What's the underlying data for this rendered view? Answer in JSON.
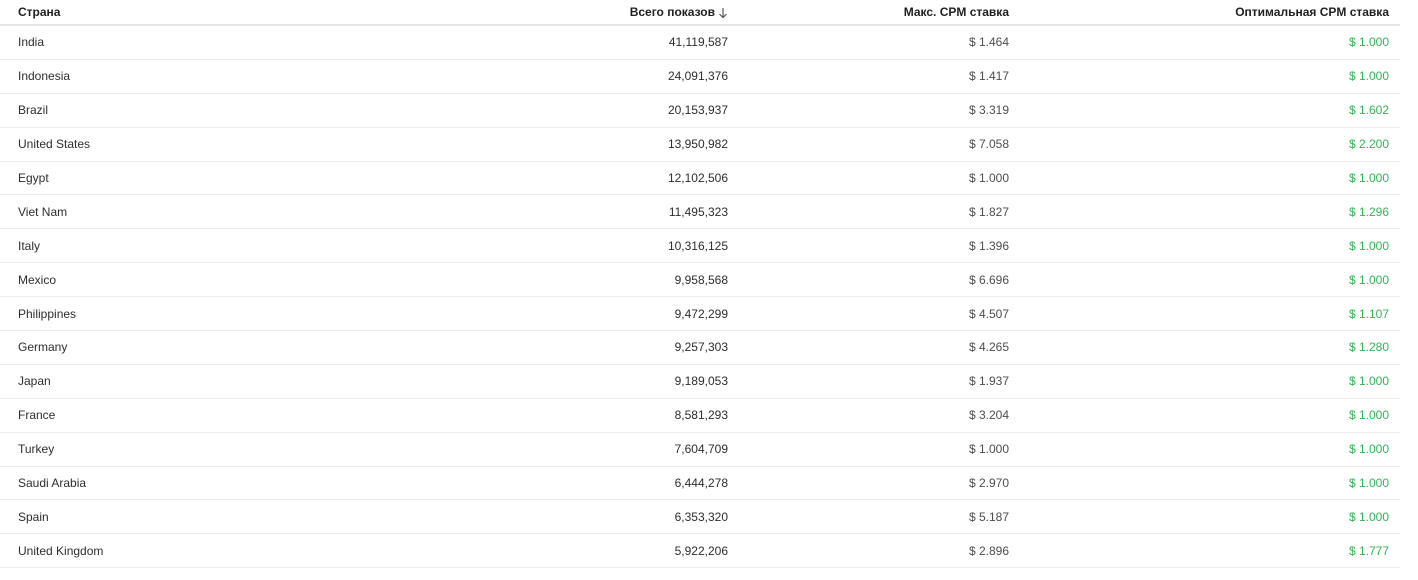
{
  "table": {
    "columns": {
      "country": "Страна",
      "impressions": "Всего показов",
      "max_cpm": "Макс. CPM ставка",
      "optimal_cpm": "Оптимальная CPM ставка"
    },
    "sort": {
      "column": "impressions",
      "direction": "desc",
      "icon": "arrow-down-icon"
    },
    "rows": [
      {
        "country": "India",
        "impressions": "41,119,587",
        "max_cpm": "$ 1.464",
        "optimal_cpm": "$ 1.000"
      },
      {
        "country": "Indonesia",
        "impressions": "24,091,376",
        "max_cpm": "$ 1.417",
        "optimal_cpm": "$ 1.000"
      },
      {
        "country": "Brazil",
        "impressions": "20,153,937",
        "max_cpm": "$ 3.319",
        "optimal_cpm": "$ 1.602"
      },
      {
        "country": "United States",
        "impressions": "13,950,982",
        "max_cpm": "$ 7.058",
        "optimal_cpm": "$ 2.200"
      },
      {
        "country": "Egypt",
        "impressions": "12,102,506",
        "max_cpm": "$ 1.000",
        "optimal_cpm": "$ 1.000"
      },
      {
        "country": "Viet Nam",
        "impressions": "11,495,323",
        "max_cpm": "$ 1.827",
        "optimal_cpm": "$ 1.296"
      },
      {
        "country": "Italy",
        "impressions": "10,316,125",
        "max_cpm": "$ 1.396",
        "optimal_cpm": "$ 1.000"
      },
      {
        "country": "Mexico",
        "impressions": "9,958,568",
        "max_cpm": "$ 6.696",
        "optimal_cpm": "$ 1.000"
      },
      {
        "country": "Philippines",
        "impressions": "9,472,299",
        "max_cpm": "$ 4.507",
        "optimal_cpm": "$ 1.107"
      },
      {
        "country": "Germany",
        "impressions": "9,257,303",
        "max_cpm": "$ 4.265",
        "optimal_cpm": "$ 1.280"
      },
      {
        "country": "Japan",
        "impressions": "9,189,053",
        "max_cpm": "$ 1.937",
        "optimal_cpm": "$ 1.000"
      },
      {
        "country": "France",
        "impressions": "8,581,293",
        "max_cpm": "$ 3.204",
        "optimal_cpm": "$ 1.000"
      },
      {
        "country": "Turkey",
        "impressions": "7,604,709",
        "max_cpm": "$ 1.000",
        "optimal_cpm": "$ 1.000"
      },
      {
        "country": "Saudi Arabia",
        "impressions": "6,444,278",
        "max_cpm": "$ 2.970",
        "optimal_cpm": "$ 1.000"
      },
      {
        "country": "Spain",
        "impressions": "6,353,320",
        "max_cpm": "$ 5.187",
        "optimal_cpm": "$ 1.000"
      },
      {
        "country": "United Kingdom",
        "impressions": "5,922,206",
        "max_cpm": "$ 2.896",
        "optimal_cpm": "$ 1.777"
      }
    ]
  },
  "colors": {
    "optimal_green": "#34b35a",
    "text": "#2d2d2d",
    "divider": "#ececec"
  }
}
